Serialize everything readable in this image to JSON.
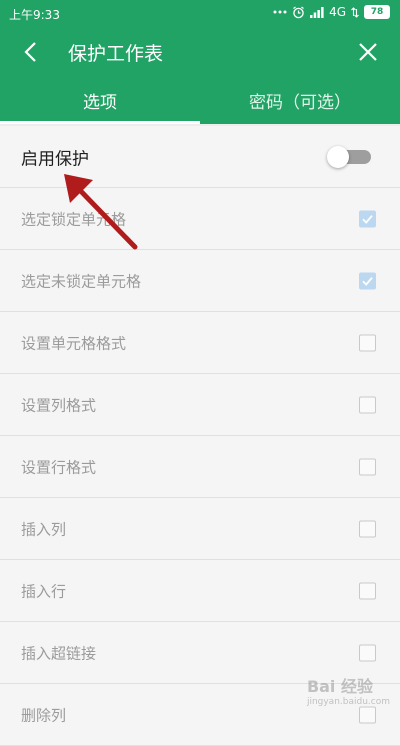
{
  "status_bar": {
    "time": "上午9:33",
    "network": "4G",
    "battery": "78"
  },
  "header": {
    "title": "保护工作表",
    "back_icon": "back-arrow-icon",
    "close_icon": "close-icon"
  },
  "tabs": [
    {
      "label": "选项",
      "active": true
    },
    {
      "label": "密码（可选）",
      "active": false
    }
  ],
  "protection_toggle": {
    "label": "启用保护",
    "enabled": false
  },
  "options": [
    {
      "label": "选定锁定单元格",
      "checked": true
    },
    {
      "label": "选定未锁定单元格",
      "checked": true
    },
    {
      "label": "设置单元格格式",
      "checked": false
    },
    {
      "label": "设置列格式",
      "checked": false
    },
    {
      "label": "设置行格式",
      "checked": false
    },
    {
      "label": "插入列",
      "checked": false
    },
    {
      "label": "插入行",
      "checked": false
    },
    {
      "label": "插入超链接",
      "checked": false
    },
    {
      "label": "删除列",
      "checked": false
    }
  ],
  "watermark": {
    "brand": "Bai 经验",
    "url": "jingyan.baidu.com"
  },
  "colors": {
    "header_bg": "#21a366",
    "checked_box": "#bcd8f1",
    "annotation_arrow": "#b01c1c"
  }
}
